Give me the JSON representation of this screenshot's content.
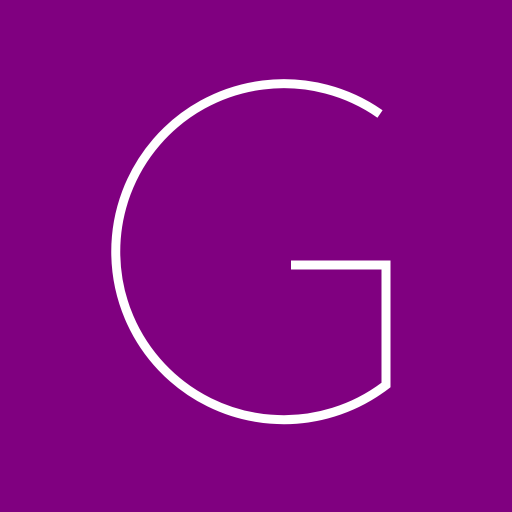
{
  "tile": {
    "letter": "G",
    "background_color": "#800080",
    "letter_color": "#ffffff"
  }
}
